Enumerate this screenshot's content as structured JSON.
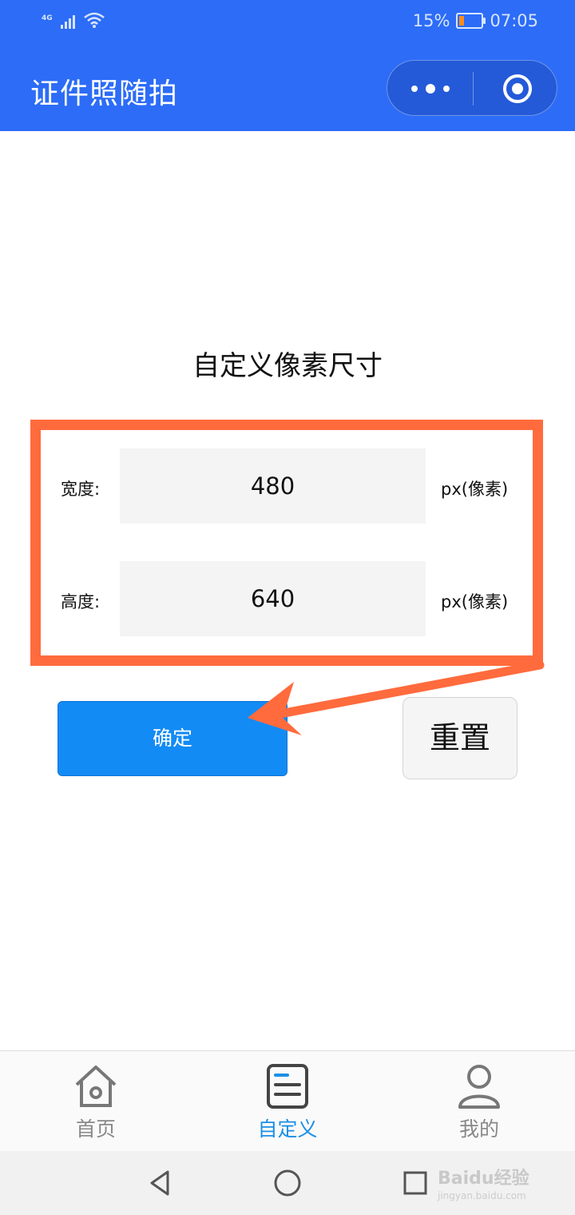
{
  "status_bar": {
    "network": "4G",
    "battery_percent": "15%",
    "time": "07:05"
  },
  "app": {
    "title": "证件照随拍"
  },
  "page": {
    "heading": "自定义像素尺寸",
    "width_label": "宽度:",
    "width_value": "480",
    "width_unit": "px(像素)",
    "height_label": "高度:",
    "height_value": "640",
    "height_unit": "px(像素)",
    "confirm_label": "确定",
    "reset_label": "重置"
  },
  "tabbar": {
    "items": [
      {
        "label": "首页",
        "icon": "home-icon",
        "active": false
      },
      {
        "label": "自定义",
        "icon": "document-icon",
        "active": true
      },
      {
        "label": "我的",
        "icon": "user-icon",
        "active": false
      }
    ]
  },
  "watermark": {
    "text": "Baidu经验",
    "sub": "jingyan.baidu.com"
  },
  "colors": {
    "brand": "#2c6cf7",
    "primary_button": "#138bf5",
    "highlight": "#ff6b3d",
    "active_tab": "#1a8fe6"
  }
}
